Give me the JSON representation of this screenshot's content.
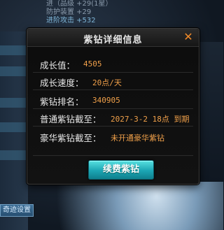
{
  "background": {
    "top_lines": [
      "进（品级    +29(1星）",
      "防护装置   +29",
      "进阶攻击          +532"
    ],
    "left_tag": "奇迹设置"
  },
  "dialog": {
    "title": "紫钻详细信息",
    "close_label": "✕",
    "rows": [
      {
        "label": "成长值：",
        "value": "4505"
      },
      {
        "label": "成长速度：",
        "value": "20点/天"
      },
      {
        "label": "紫钻排名：",
        "value": "340905"
      },
      {
        "label": "普通紫钻截至：",
        "value": "2027-3-2 18点 到期"
      },
      {
        "label": "豪华紫钻截至：",
        "value": "未开通豪华紫钻"
      }
    ],
    "renew_button": "续费紫钻"
  },
  "colors": {
    "value": "#f0a04a",
    "close": "#f08a2a",
    "button": "#1ba5b3"
  }
}
